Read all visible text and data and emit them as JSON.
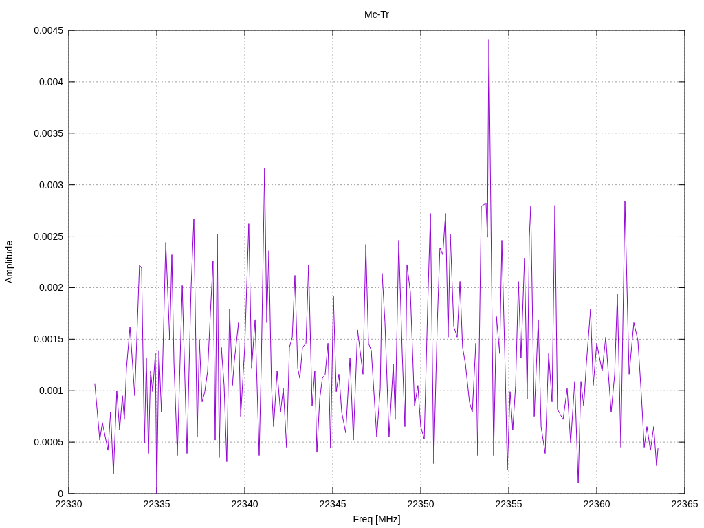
{
  "chart_data": {
    "type": "line",
    "title": "Mc-Tr",
    "xlabel": "Freq [MHz]",
    "ylabel": "Amplitude",
    "grid": true,
    "xlim": [
      22330,
      22365
    ],
    "ylim": [
      0,
      0.0045
    ],
    "xticks": [
      22330,
      22335,
      22340,
      22345,
      22350,
      22355,
      22360,
      22365
    ],
    "yticks": [
      0,
      0.0005,
      0.001,
      0.0015,
      0.002,
      0.0025,
      0.003,
      0.0035,
      0.004,
      0.0045
    ],
    "x": [
      22331.48,
      22331.76,
      22331.91,
      22332.23,
      22332.38,
      22332.54,
      22332.73,
      22332.89,
      22333.05,
      22333.16,
      22333.28,
      22333.48,
      22333.75,
      22334.02,
      22334.14,
      22334.3,
      22334.41,
      22334.53,
      22334.65,
      22334.77,
      22334.92,
      22335.0,
      22335.12,
      22335.27,
      22335.51,
      22335.74,
      22335.86,
      22335.98,
      22336.17,
      22336.45,
      22336.72,
      22336.95,
      22337.11,
      22337.3,
      22337.42,
      22337.58,
      22337.73,
      22337.89,
      22338.05,
      22338.2,
      22338.32,
      22338.44,
      22338.55,
      22338.67,
      22338.83,
      22338.98,
      22339.14,
      22339.3,
      22339.41,
      22339.65,
      22339.77,
      22340.0,
      22340.23,
      22340.39,
      22340.59,
      22340.82,
      22340.94,
      22341.13,
      22341.25,
      22341.37,
      22341.52,
      22341.64,
      22341.84,
      22342.03,
      22342.19,
      22342.38,
      22342.54,
      22342.7,
      22342.85,
      22343.01,
      22343.13,
      22343.28,
      22343.48,
      22343.63,
      22343.83,
      22343.98,
      22344.1,
      22344.26,
      22344.41,
      22344.57,
      22344.73,
      22344.88,
      22345.04,
      22345.2,
      22345.35,
      22345.51,
      22345.74,
      22345.98,
      22346.17,
      22346.41,
      22346.72,
      22346.88,
      22347.03,
      22347.19,
      22347.5,
      22347.7,
      22347.81,
      22347.97,
      22348.2,
      22348.44,
      22348.55,
      22348.75,
      22348.95,
      22349.1,
      22349.22,
      22349.41,
      22349.65,
      22349.84,
      22350.0,
      22350.2,
      22350.39,
      22350.55,
      22350.74,
      22350.94,
      22351.09,
      22351.25,
      22351.41,
      22351.56,
      22351.68,
      22351.88,
      22352.07,
      22352.23,
      22352.38,
      22352.54,
      22352.77,
      22352.93,
      22353.13,
      22353.24,
      22353.44,
      22353.71,
      22353.79,
      22353.87,
      22353.98,
      22354.14,
      22354.3,
      22354.49,
      22354.61,
      22354.8,
      22354.92,
      22355.08,
      22355.23,
      22355.39,
      22355.55,
      22355.7,
      22355.9,
      22356.05,
      22356.17,
      22356.25,
      22356.45,
      22356.68,
      22356.84,
      22357.07,
      22357.27,
      22357.46,
      22357.62,
      22357.77,
      22358.09,
      22358.32,
      22358.52,
      22358.75,
      22358.95,
      22359.1,
      22359.26,
      22359.41,
      22359.65,
      22359.8,
      22360.0,
      22360.16,
      22360.31,
      22360.51,
      22360.82,
      22361.02,
      22361.17,
      22361.37,
      22361.6,
      22361.84,
      22362.11,
      22362.34,
      22362.54,
      22362.7,
      22362.85,
      22363.05,
      22363.24,
      22363.4,
      22363.48
    ],
    "values": [
      0.00107,
      0.00052,
      0.00069,
      0.00042,
      0.00079,
      0.00019,
      0.001,
      0.00062,
      0.00095,
      0.00072,
      0.00122,
      0.00162,
      0.00095,
      0.00222,
      0.00219,
      0.00049,
      0.00132,
      0.00039,
      0.00119,
      0.00099,
      0.00136,
      0,
      0.00139,
      0.00079,
      0.00244,
      0.00149,
      0.00232,
      0.00126,
      0.00037,
      0.00202,
      0.00039,
      0.00199,
      0.00267,
      0.00055,
      0.00149,
      0.00089,
      0.00099,
      0.00119,
      0.00176,
      0.00226,
      0.00052,
      0.00252,
      0.00035,
      0.00142,
      0.00105,
      0.00031,
      0.00179,
      0.00105,
      0.00129,
      0.00166,
      0.00075,
      0.00142,
      0.00262,
      0.00122,
      0.00169,
      0.00037,
      0.00126,
      0.00316,
      0.00166,
      0.00236,
      0.00105,
      0.00065,
      0.00119,
      0.00079,
      0.00102,
      0.00045,
      0.00142,
      0.00152,
      0.00212,
      0.00122,
      0.00112,
      0.00142,
      0.00146,
      0.00222,
      0.00085,
      0.00119,
      0.0004,
      0.00092,
      0.00112,
      0.00116,
      0.00146,
      0.00044,
      0.00192,
      0.00099,
      0.00116,
      0.00079,
      0.00059,
      0.00132,
      0.00052,
      0.00159,
      0.00116,
      0.00242,
      0.00146,
      0.00139,
      0.00055,
      0.00102,
      0.00214,
      0.00166,
      0.00055,
      0.00126,
      0.00072,
      0.00246,
      0.00136,
      0.00065,
      0.00222,
      0.00196,
      0.00085,
      0.00105,
      0.00065,
      0.00053,
      0.00179,
      0.00272,
      0.00029,
      0.00166,
      0.00239,
      0.00232,
      0.00272,
      0.00152,
      0.00252,
      0.00162,
      0.00152,
      0.00206,
      0.00142,
      0.00126,
      0.00089,
      0.00079,
      0.00146,
      0.00037,
      0.00279,
      0.00282,
      0.00249,
      0.00441,
      0.00279,
      0.00037,
      0.00172,
      0.00136,
      0.00246,
      0.00119,
      0.00023,
      0.00099,
      0.00062,
      0.00105,
      0.00206,
      0.00132,
      0.00229,
      0.00092,
      0.00249,
      0.00279,
      0.00075,
      0.00169,
      0.00065,
      0.00039,
      0.00136,
      0.00089,
      0.0028,
      0.00082,
      0.00072,
      0.00102,
      0.00049,
      0.00109,
      0.0001,
      0.00109,
      0.00085,
      0.00126,
      0.00179,
      0.00105,
      0.00146,
      0.00132,
      0.00119,
      0.00152,
      0.00079,
      0.00116,
      0.00194,
      0.00045,
      0.00284,
      0.00116,
      0.00166,
      0.00149,
      0.00095,
      0.00045,
      0.00065,
      0.00042,
      0.00065,
      0.00027,
      0.00044
    ]
  }
}
